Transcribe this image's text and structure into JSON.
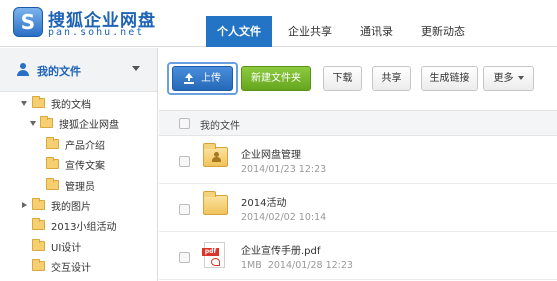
{
  "brand": {
    "name": "搜狐企业网盘",
    "url": "pan.sohu.net",
    "logo_letter": "S"
  },
  "nav": {
    "tabs": [
      "个人文件",
      "企业共享",
      "通讯录",
      "更新动态"
    ],
    "active": "个人文件"
  },
  "sidebar": {
    "title": "我的文件",
    "items": [
      {
        "label": "我的文档",
        "toggle": "open"
      },
      {
        "label": "搜狐企业网盘",
        "toggle": "open"
      },
      {
        "label": "产品介绍",
        "toggle": ""
      },
      {
        "label": "宣传文案",
        "toggle": ""
      },
      {
        "label": "管理员",
        "toggle": ""
      },
      {
        "label": "我的图片",
        "toggle": "closed"
      },
      {
        "label": "2013小组活动",
        "toggle": ""
      },
      {
        "label": "UI设计",
        "toggle": ""
      },
      {
        "label": "交互设计",
        "toggle": ""
      }
    ]
  },
  "toolbar": {
    "upload": "上传",
    "new_folder": "新建文件夹",
    "download": "下载",
    "share": "共享",
    "create_link": "生成链接",
    "more": "更多"
  },
  "list": {
    "header": "我的文件",
    "rows": [
      {
        "name": "企业网盘管理",
        "size": "",
        "date": "2014/01/23 12:23",
        "icon": "shared-folder-icon"
      },
      {
        "name": "2014活动",
        "size": "",
        "date": "2014/02/02 10:14",
        "icon": "folder-icon"
      },
      {
        "name": "企业宣传手册.pdf",
        "size": "1MB",
        "date": "2014/01/28 12:23",
        "icon": "pdf-file-icon",
        "icon_label": "pdf"
      }
    ]
  },
  "colors": {
    "accent": "#2474c5",
    "green": "#66a61f",
    "folder": "#f5cf72",
    "pdf": "#d9352b"
  }
}
